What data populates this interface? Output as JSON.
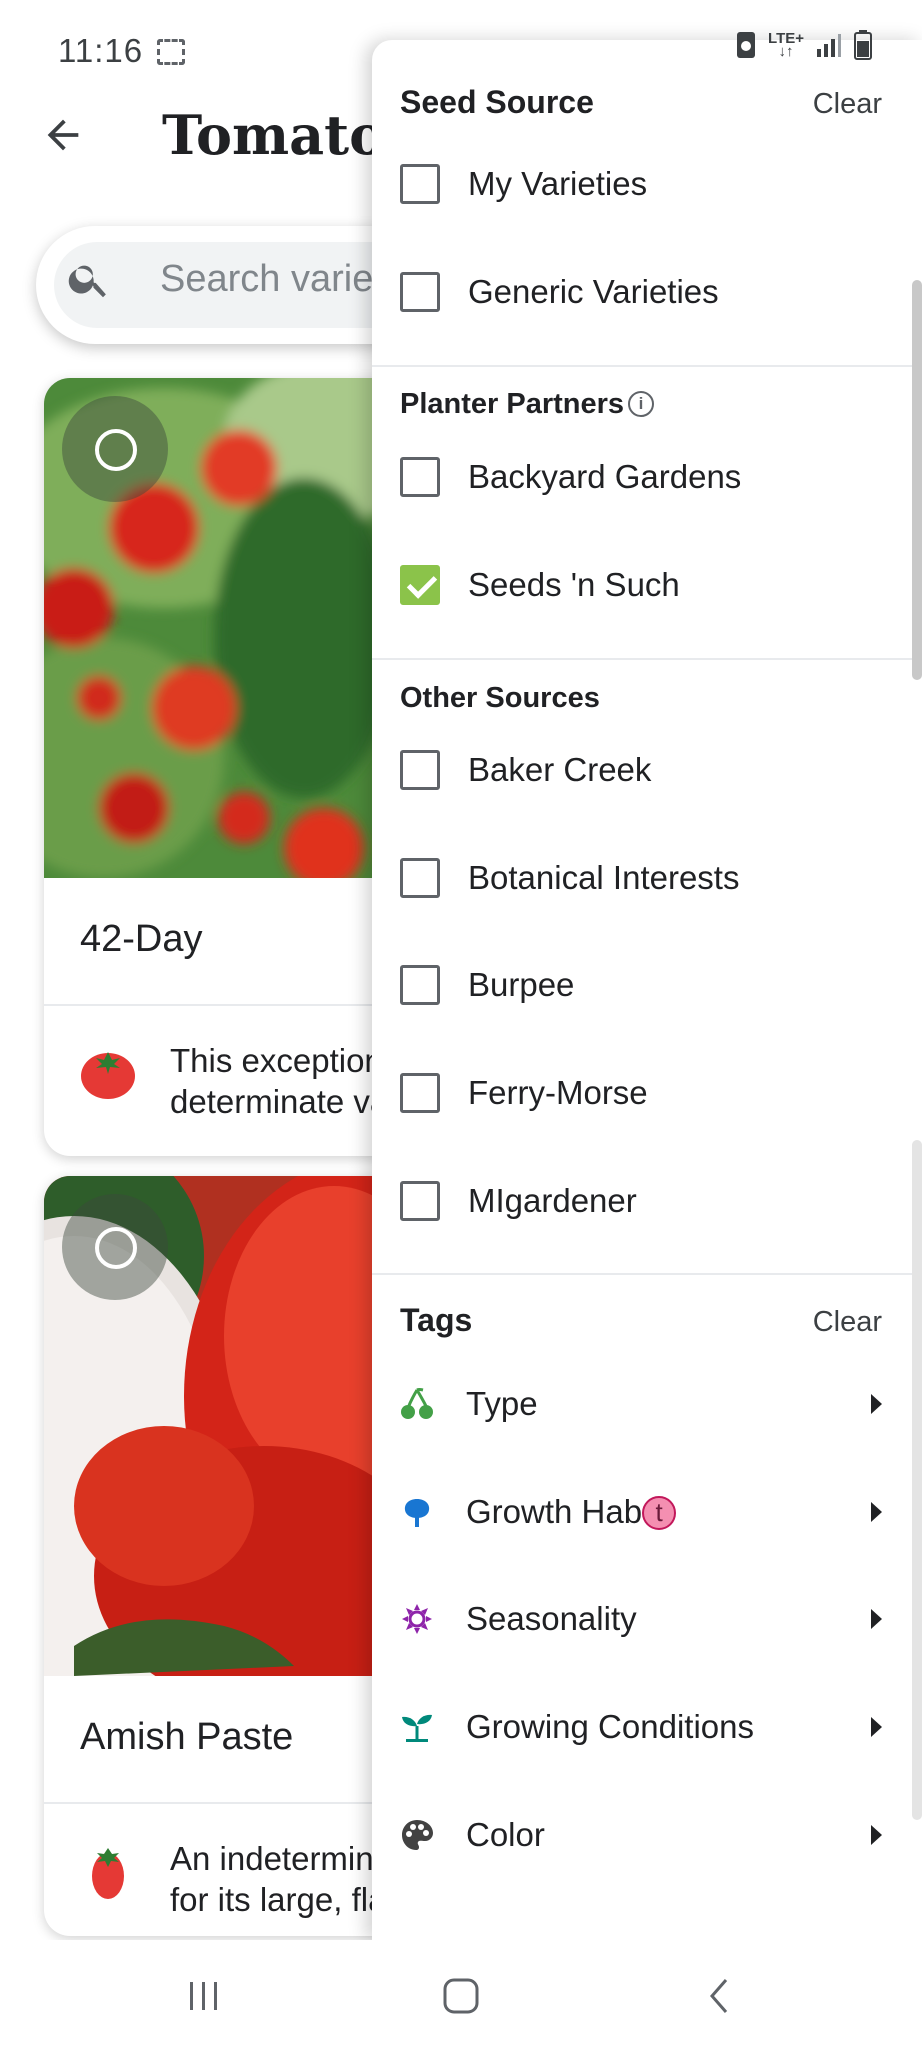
{
  "status_bar": {
    "time": "11:16",
    "network": "LTE+"
  },
  "header": {
    "title": "Tomatoes"
  },
  "search": {
    "placeholder": "Search varieties"
  },
  "cards": [
    {
      "name": "42-Day",
      "description": "This exceptional\ndeterminate variety"
    },
    {
      "name": "Amish Paste",
      "description": "An indeterminate\nfor its large, flavorful"
    }
  ],
  "filter_drawer": {
    "seed_source": {
      "title": "Seed Source",
      "clear_label": "Clear",
      "options": [
        {
          "label": "My Varieties",
          "checked": false
        },
        {
          "label": "Generic Varieties",
          "checked": false
        }
      ]
    },
    "planter_partners": {
      "title": "Planter Partners",
      "options": [
        {
          "label": "Backyard Gardens",
          "checked": false
        },
        {
          "label": "Seeds 'n Such",
          "checked": true
        }
      ]
    },
    "other_sources": {
      "title": "Other Sources",
      "options": [
        {
          "label": "Baker Creek",
          "checked": false
        },
        {
          "label": "Botanical Interests",
          "checked": false
        },
        {
          "label": "Burpee",
          "checked": false
        },
        {
          "label": "Ferry-Morse",
          "checked": false
        },
        {
          "label": "MIgardener",
          "checked": false
        }
      ]
    },
    "tags": {
      "title": "Tags",
      "clear_label": "Clear",
      "items": [
        {
          "label": "Type",
          "icon": "cherry-icon",
          "color": "#43a047"
        },
        {
          "label": "Growth Hab",
          "suffix": "t",
          "icon": "tree-icon",
          "color": "#1976d2"
        },
        {
          "label": "Seasonality",
          "icon": "sun-icon",
          "color": "#8e24aa"
        },
        {
          "label": "Growing Conditions",
          "icon": "sprout-icon",
          "color": "#00897b"
        },
        {
          "label": "Color",
          "icon": "palette-icon",
          "color": "#424242"
        }
      ]
    }
  },
  "colors": {
    "checkbox_checked": "#8bc34a",
    "text": "#202124"
  }
}
